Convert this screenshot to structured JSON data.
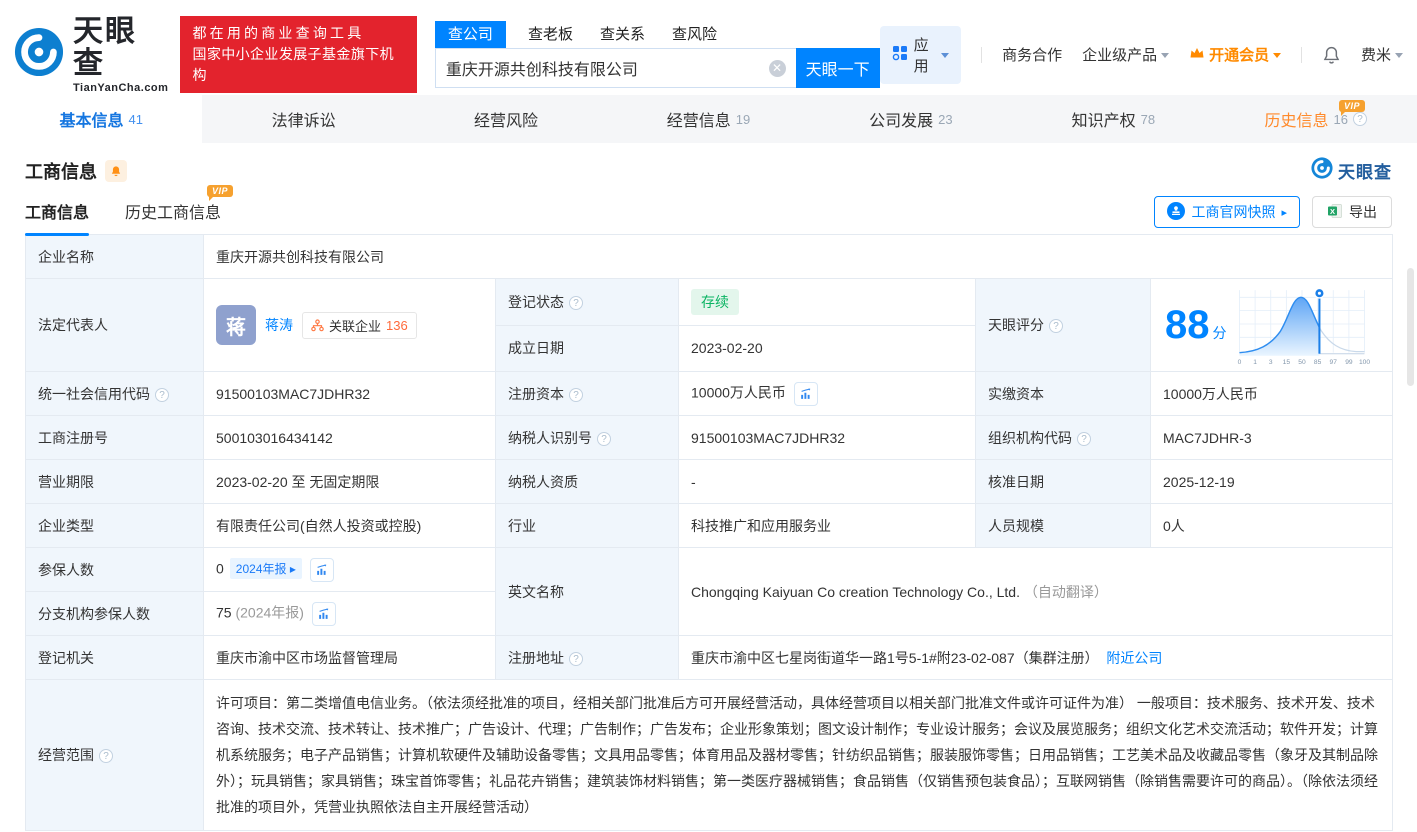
{
  "colors": {
    "brand": "#0084ff",
    "vip_orange": "#f6a12f",
    "promo_red": "#e3232d",
    "status_green": "#0bb463"
  },
  "header": {
    "logo_title": "天眼查",
    "logo_subtitle": "TianYanCha.com",
    "promo_line1": "都在用的商业查询工具",
    "promo_line2": "国家中小企业发展子基金旗下机构",
    "search_tabs": [
      {
        "label": "查公司"
      },
      {
        "label": "查老板"
      },
      {
        "label": "查关系"
      },
      {
        "label": "查风险"
      }
    ],
    "search_value": "重庆开源共创科技有限公司",
    "search_button": "天眼一下",
    "menu": {
      "apps": "应用",
      "cooperation": "商务合作",
      "enterprise": "企业级产品",
      "vip": "开通会员",
      "user": "费米"
    }
  },
  "nav": {
    "tabs": [
      {
        "label": "基本信息",
        "count": "41"
      },
      {
        "label": "法律诉讼",
        "count": ""
      },
      {
        "label": "经营风险",
        "count": ""
      },
      {
        "label": "经营信息",
        "count": "19"
      },
      {
        "label": "公司发展",
        "count": "23"
      },
      {
        "label": "知识产权",
        "count": "78"
      },
      {
        "label": "历史信息",
        "count": "16"
      }
    ]
  },
  "section": {
    "title": "工商信息",
    "brand": "天眼查",
    "vip": "VIP",
    "subtab_current": "工商信息",
    "subtab_history": "历史工商信息",
    "snapshot_button": "工商官网快照",
    "export_button": "导出"
  },
  "table": {
    "company_name": {
      "label": "企业名称",
      "value": "重庆开源共创科技有限公司"
    },
    "legal_rep": {
      "label": "法定代表人",
      "avatar": "蒋",
      "name": "蒋涛",
      "related": "关联企业",
      "related_count": "136"
    },
    "reg_status": {
      "label": "登记状态",
      "value": "存续"
    },
    "establish_date": {
      "label": "成立日期",
      "value": "2023-02-20"
    },
    "score": {
      "label": "天眼评分",
      "value": "88",
      "unit": "分",
      "axis": [
        "0",
        "1",
        "3",
        "15",
        "50",
        "85",
        "97",
        "99",
        "100"
      ]
    },
    "credit_code": {
      "label": "统一社会信用代码",
      "value": "91500103MAC7JDHR32"
    },
    "reg_capital": {
      "label": "注册资本",
      "value": "10000万人民币"
    },
    "paid_capital": {
      "label": "实缴资本",
      "value": "10000万人民币"
    },
    "reg_number": {
      "label": "工商注册号",
      "value": "500103016434142"
    },
    "taxpayer_id": {
      "label": "纳税人识别号",
      "value": "91500103MAC7JDHR32"
    },
    "org_code": {
      "label": "组织机构代码",
      "value": "MAC7JDHR-3"
    },
    "business_term": {
      "label": "营业期限",
      "value": "2023-02-20 至 无固定期限"
    },
    "taxpayer_quality": {
      "label": "纳税人资质",
      "value": "-"
    },
    "approval_date": {
      "label": "核准日期",
      "value": "2025-12-19"
    },
    "company_type": {
      "label": "企业类型",
      "value": "有限责任公司(自然人投资或控股)"
    },
    "industry": {
      "label": "行业",
      "value": "科技推广和应用服务业"
    },
    "staff_size": {
      "label": "人员规模",
      "value": "0人"
    },
    "insured": {
      "label": "参保人数",
      "value": "0",
      "badge": "2024年报 ▸"
    },
    "branch_insured": {
      "label": "分支机构参保人数",
      "value": "75",
      "note": "(2024年报)"
    },
    "english_name": {
      "label": "英文名称",
      "value": "Chongqing Kaiyuan Co creation Technology Co., Ltd.",
      "note": "（自动翻译）"
    },
    "reg_authority": {
      "label": "登记机关",
      "value": "重庆市渝中区市场监督管理局"
    },
    "reg_address": {
      "label": "注册地址",
      "value": "重庆市渝中区七星岗街道华一路1号5-1#附23-02-087（集群注册）",
      "link": "附近公司"
    },
    "business_scope": {
      "label": "经营范围",
      "value": "许可项目：第二类增值电信业务。（依法须经批准的项目，经相关部门批准后方可开展经营活动，具体经营项目以相关部门批准文件或许可证件为准） 一般项目：技术服务、技术开发、技术咨询、技术交流、技术转让、技术推广；广告设计、代理；广告制作；广告发布；企业形象策划；图文设计制作；专业设计服务；会议及展览服务；组织文化艺术交流活动；软件开发；计算机系统服务；电子产品销售；计算机软硬件及辅助设备零售；文具用品零售；体育用品及器材零售；针纺织品销售；服装服饰零售；日用品销售；工艺美术品及收藏品零售（象牙及其制品除外）；玩具销售；家具销售；珠宝首饰零售；礼品花卉销售；建筑装饰材料销售；第一类医疗器械销售；食品销售（仅销售预包装食品）；互联网销售（除销售需要许可的商品）。（除依法须经批准的项目外，凭营业执照依法自主开展经营活动）"
    }
  }
}
